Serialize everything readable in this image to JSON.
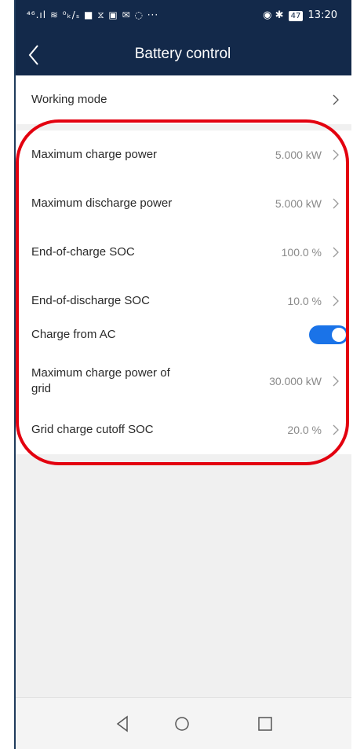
{
  "status_bar": {
    "left_icons": "⁴⁶.ıl ≋ ⁰ₖ/ₛ ■ ⧖ ▣ ✉ ◌ ···",
    "right_icons": "◉ ✱",
    "battery": "47",
    "time": "13:20"
  },
  "header": {
    "title": "Battery control"
  },
  "section1": {
    "items": [
      {
        "label": "Working mode",
        "value": ""
      }
    ]
  },
  "section2": {
    "items": [
      {
        "label": "Maximum charge power",
        "value": "5.000 kW"
      },
      {
        "label": "Maximum discharge power",
        "value": "5.000 kW"
      },
      {
        "label": "End-of-charge SOC",
        "value": "100.0 %"
      },
      {
        "label": "End-of-discharge SOC",
        "value": "10.0 %"
      }
    ]
  },
  "section3": {
    "toggle": {
      "label": "Charge from AC",
      "on": true
    },
    "items": [
      {
        "label": "Maximum charge power of grid",
        "value": "30.000 kW"
      },
      {
        "label": "Grid charge cutoff SOC",
        "value": "20.0 %"
      }
    ]
  },
  "colors": {
    "header_bg": "#13294a",
    "toggle_on": "#1a73e8",
    "highlight": "#e3000f"
  },
  "icons": {
    "back": "back-arrow-icon",
    "chevron": "chevron-right-icon",
    "nav_back": "triangle-back-icon",
    "nav_home": "circle-home-icon",
    "nav_recent": "square-recent-icon"
  }
}
